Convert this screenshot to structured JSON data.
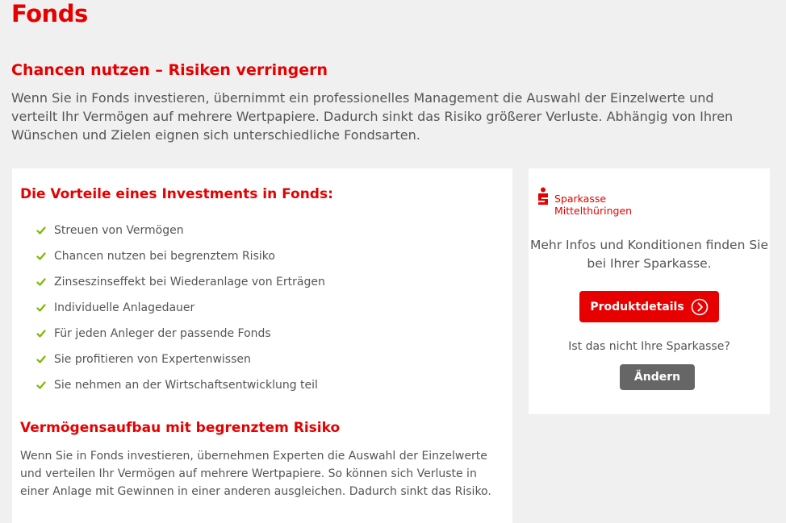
{
  "page": {
    "title": "Fonds",
    "intro_heading": "Chancen nutzen – Risiken verringern",
    "intro_text": "Wenn Sie in Fonds investieren, übernimmt ein professionelles Management die Auswahl der Einzelwerte und verteilt Ihr Vermögen auf mehrere Wertpapiere. Dadurch sinkt das Risiko größerer Verluste. Abhängig von Ihren Wünschen und Zielen eignen sich unterschiedliche Fondsarten."
  },
  "benefits_card": {
    "heading": "Die Vorteile eines Investments in Fonds:",
    "items": [
      "Streuen von Vermögen",
      "Chancen nutzen bei begrenztem Risiko",
      "Zinseszinseffekt bei Wiederanlage von Erträgen",
      "Individuelle Anlagedauer",
      "Für jeden Anleger der passende Fonds",
      "Sie profitieren von Expertenwissen",
      "Sie nehmen an der Wirtschaftsentwicklung teil"
    ],
    "subheading": "Vermögensaufbau mit begrenztem Risiko",
    "body": "Wenn Sie in Fonds investieren, übernehmen Experten die Auswahl der Einzelwerte und verteilen Ihr Vermögen auf mehrere Wertpapiere. So können sich Verluste in einer Anlage mit Gewinnen in einer anderen ausgleichen. Dadurch sinkt das Risiko."
  },
  "sparkasse_card": {
    "logo_line1": "Sparkasse",
    "logo_line2": "Mittelthüringen",
    "info": "Mehr Infos und Konditionen finden Sie bei Ihrer Sparkasse.",
    "details_button": "Produktdetails",
    "question": "Ist das nicht Ihre Sparkasse?",
    "change_button": "Ändern"
  },
  "colors": {
    "brand_red": "#e60000",
    "check_green": "#7ab800",
    "button_gray": "#666666"
  },
  "icons": {
    "check": "check-icon",
    "logo": "sparkasse-s-logo",
    "arrow": "circle-arrow-right-icon"
  }
}
